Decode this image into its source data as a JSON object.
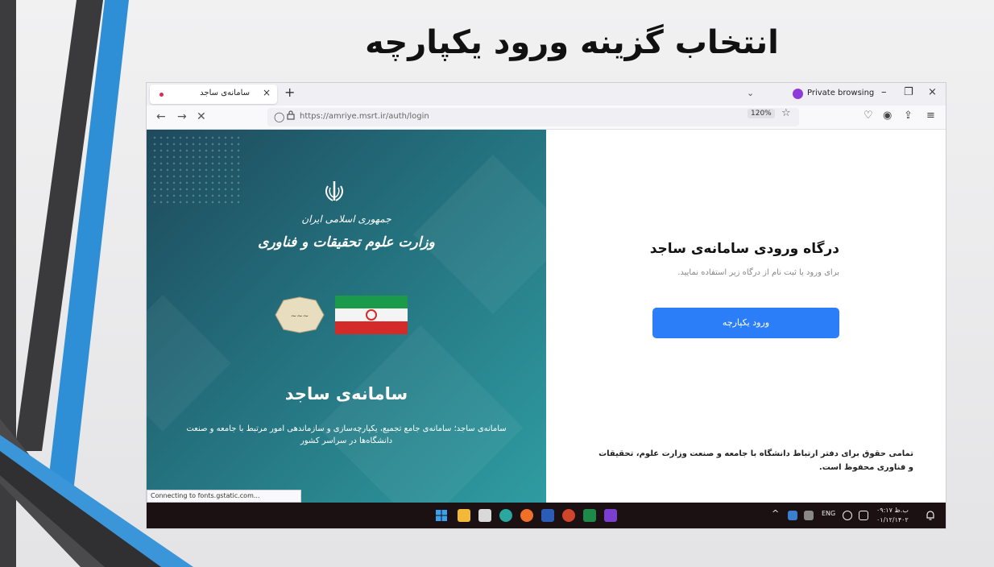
{
  "slide": {
    "title": "انتخاب گزینه ورود یکپارچه"
  },
  "browser": {
    "tab": {
      "title": "سامانه‌ی ساجد",
      "close_icon": "×"
    },
    "new_tab_icon": "+",
    "tab_list_icon": "⌄",
    "private_browsing_label": "Private browsing",
    "window_controls": {
      "minimize": "–",
      "restore": "❐",
      "close": "×"
    },
    "nav": {
      "back": "←",
      "forward": "→",
      "stop": "✕"
    },
    "url": {
      "shield_icon": "◯",
      "lock_icon": "🔒",
      "text": "https://amriye.msrt.ir/auth/login",
      "zoom": "120%",
      "star_icon": "☆"
    },
    "toolbar_icons": {
      "pocket": "♡",
      "account": "◉",
      "extensions": "⇪",
      "menu": "≡"
    },
    "status": "Connecting to fonts.gstatic.com..."
  },
  "left_panel": {
    "ministry_line1": "جمهوری اسلامی ایران",
    "ministry_line2": "وزارت علوم تحقیقات و فناوری",
    "sajed_title": "سامانه‌ی ساجد",
    "sajed_desc": "سامانه‌ی ساجد؛ سامانه‌ی جامع تجمیع، یکپارچه‌سازی و سازماندهی امور مرتبط با جامعه و صنعت دانشگاه‌ها در سراسر کشور"
  },
  "right_panel": {
    "login_title": "درگاه ورودی سامانه‌ی ساجد",
    "login_subtitle": "برای ورود یا ثبت نام از درگاه زیر استفاده نمایید.",
    "sso_button_label": "ورود یکپارچه",
    "footer": "تمامی حقوق برای دفتر ارتباط دانشگاه با جامعه و صنعت وزارت علوم، تحقیقات و فناوری محفوظ است."
  },
  "taskbar": {
    "tray": {
      "chevron": "^",
      "lang": "ENG",
      "time": "ب.ظ ۰۹:۱۷",
      "date": "۰۱/۱۲/۱۴۰۲",
      "bell": "🔔"
    }
  },
  "colors": {
    "accent": "#2c7ef8",
    "panel_start": "#1e4a5c",
    "panel_end": "#2f9ca2",
    "taskbar": "#1c1112"
  }
}
